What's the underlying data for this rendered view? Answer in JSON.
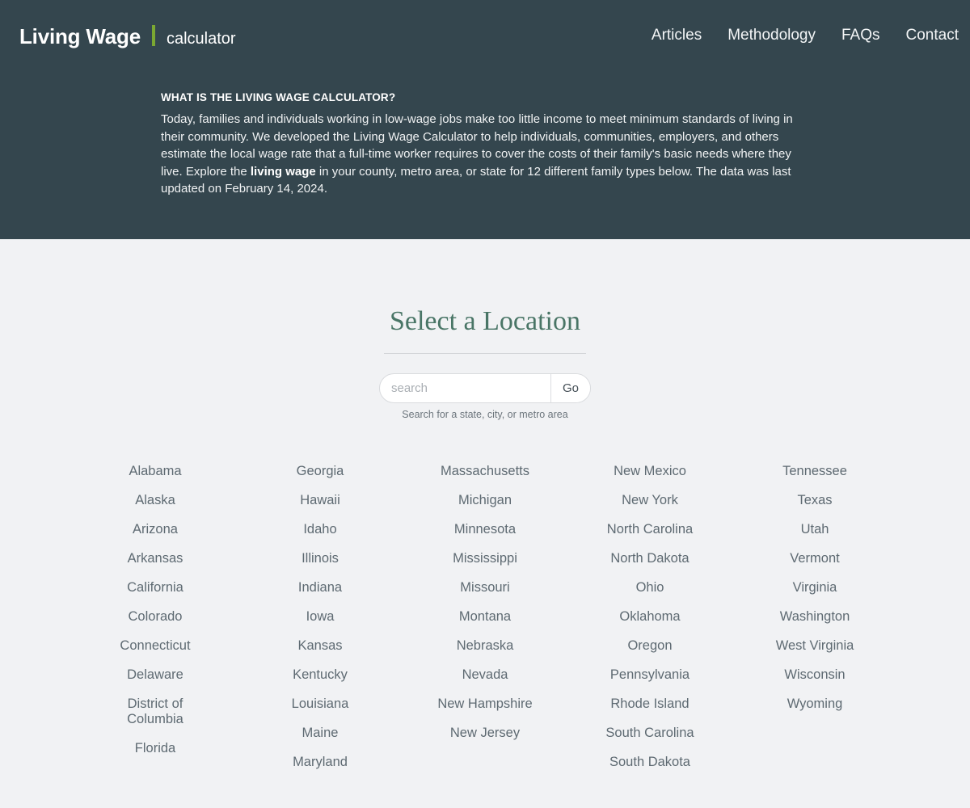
{
  "header": {
    "logo_main": "Living Wage",
    "logo_sub": "calculator",
    "nav": [
      {
        "label": "Articles",
        "name": "nav-articles"
      },
      {
        "label": "Methodology",
        "name": "nav-methodology"
      },
      {
        "label": "FAQs",
        "name": "nav-faqs"
      },
      {
        "label": "Contact",
        "name": "nav-contact"
      }
    ],
    "intro_title": "WHAT IS THE LIVING WAGE CALCULATOR?",
    "intro_body_part1": "Today, families and individuals working in low-wage jobs make too little income to meet minimum standards of living in their community. We developed the Living Wage Calculator to help individuals, communities, employers, and others estimate the local wage rate that a full-time worker requires to cover the costs of their family's basic needs where they live. Explore the ",
    "intro_bold": "living wage",
    "intro_body_part2": " in your county, metro area, or state for 12 different family types below. The data was last updated on February 14, 2024."
  },
  "main": {
    "heading": "Select a Location",
    "search": {
      "placeholder": "search",
      "value": "",
      "go_label": "Go",
      "hint": "Search for a state, city, or metro area"
    }
  },
  "colors": {
    "header_bg": "#34464e",
    "page_bg": "#f1f2f4",
    "accent_green": "#7ba832",
    "heading_green": "#497566",
    "state_text": "#5e6a72"
  },
  "state_columns": [
    [
      "Alabama",
      "Alaska",
      "Arizona",
      "Arkansas",
      "California",
      "Colorado",
      "Connecticut",
      "Delaware",
      "District of Columbia",
      "Florida"
    ],
    [
      "Georgia",
      "Hawaii",
      "Idaho",
      "Illinois",
      "Indiana",
      "Iowa",
      "Kansas",
      "Kentucky",
      "Louisiana",
      "Maine",
      "Maryland"
    ],
    [
      "Massachusetts",
      "Michigan",
      "Minnesota",
      "Mississippi",
      "Missouri",
      "Montana",
      "Nebraska",
      "Nevada",
      "New Hampshire",
      "New Jersey"
    ],
    [
      "New Mexico",
      "New York",
      "North Carolina",
      "North Dakota",
      "Ohio",
      "Oklahoma",
      "Oregon",
      "Pennsylvania",
      "Rhode Island",
      "South Carolina",
      "South Dakota"
    ],
    [
      "Tennessee",
      "Texas",
      "Utah",
      "Vermont",
      "Virginia",
      "Washington",
      "West Virginia",
      "Wisconsin",
      "Wyoming"
    ]
  ]
}
